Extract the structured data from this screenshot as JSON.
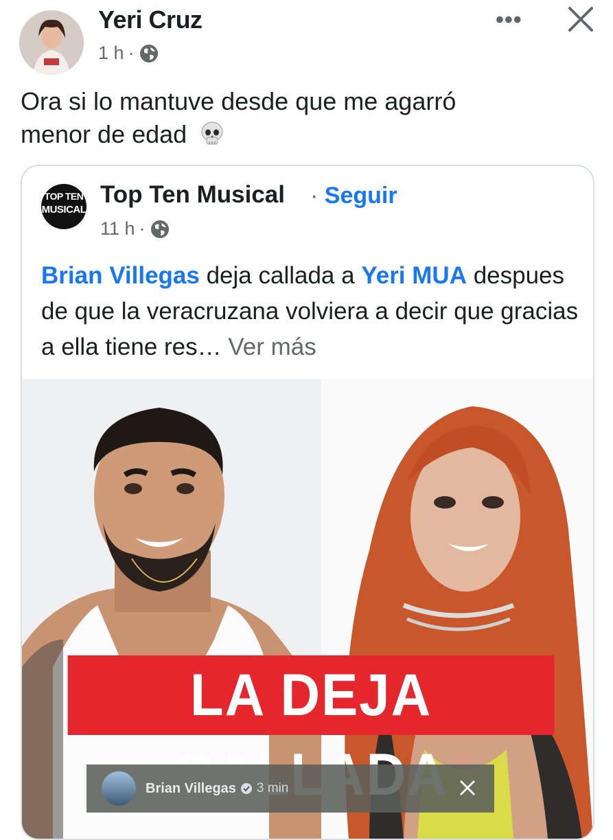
{
  "post": {
    "author": "Yeri Cruz",
    "time": "1 h",
    "caption_line1": "Ora si lo mantuve desde que me agarró",
    "caption_line2": "menor de edad"
  },
  "shared": {
    "logo_line1": "TOP TEN",
    "logo_line2": "MUSICAL",
    "page_name": "Top Ten Musical",
    "follow_label": "Seguir",
    "time": "11 h",
    "text_link1": "Brian Villegas",
    "text_part1": " deja callada a ",
    "text_link2": "Yeri MUA",
    "text_part2": " despues de que la veracruzana volviera a decir que gracias a ella tiene res…",
    "see_more": "Ver más",
    "image": {
      "banner_text": "LA DEJA CALLADA",
      "story_name": "Brian Villegas",
      "story_time": "3 min"
    }
  },
  "colors": {
    "link": "#1877f2",
    "banner": "#e6262d",
    "secondary_text": "#65676b"
  },
  "icons": [
    "globe-icon",
    "more-options-icon",
    "close-icon",
    "skull-icon",
    "verified-icon"
  ]
}
